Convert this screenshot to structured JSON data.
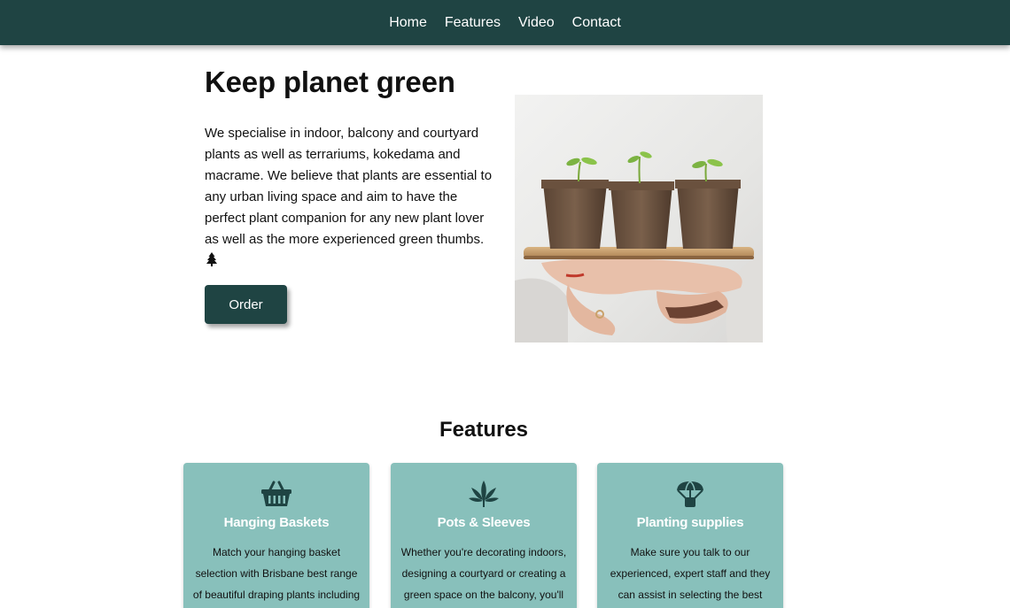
{
  "nav": {
    "items": [
      "Home",
      "Features",
      "Video",
      "Contact"
    ]
  },
  "hero": {
    "title": "Keep planet green",
    "text": "We specialise in indoor, balcony and courtyard plants as well as terrariums, kokedama and macrame. We believe that plants are essential to any urban living space and aim to have the perfect plant companion for any new plant lover as well as the more experienced green thumbs.",
    "text_icon": "tree-icon",
    "order_label": "Order",
    "image_icon": "seedling-pots-photo"
  },
  "features": {
    "title": "Features",
    "cards": [
      {
        "icon": "basket-icon",
        "title": "Hanging Baskets",
        "text": "Match your hanging basket selection with Brisbane best range of beautiful draping plants including"
      },
      {
        "icon": "cannabis-leaf-icon",
        "title": "Pots & Sleeves",
        "text": "Whether you're decorating indoors, designing a courtyard or creating a green space on the balcony, you'll"
      },
      {
        "icon": "parachute-box-icon",
        "title": "Planting supplies",
        "text": "Make sure you talk to our experienced, expert staff and they can assist in selecting the best"
      }
    ]
  },
  "colors": {
    "nav_bg": "#1f4443",
    "button_bg": "#1f4443",
    "card_bg": "#88c0bb",
    "card_title": "#ffffff"
  }
}
